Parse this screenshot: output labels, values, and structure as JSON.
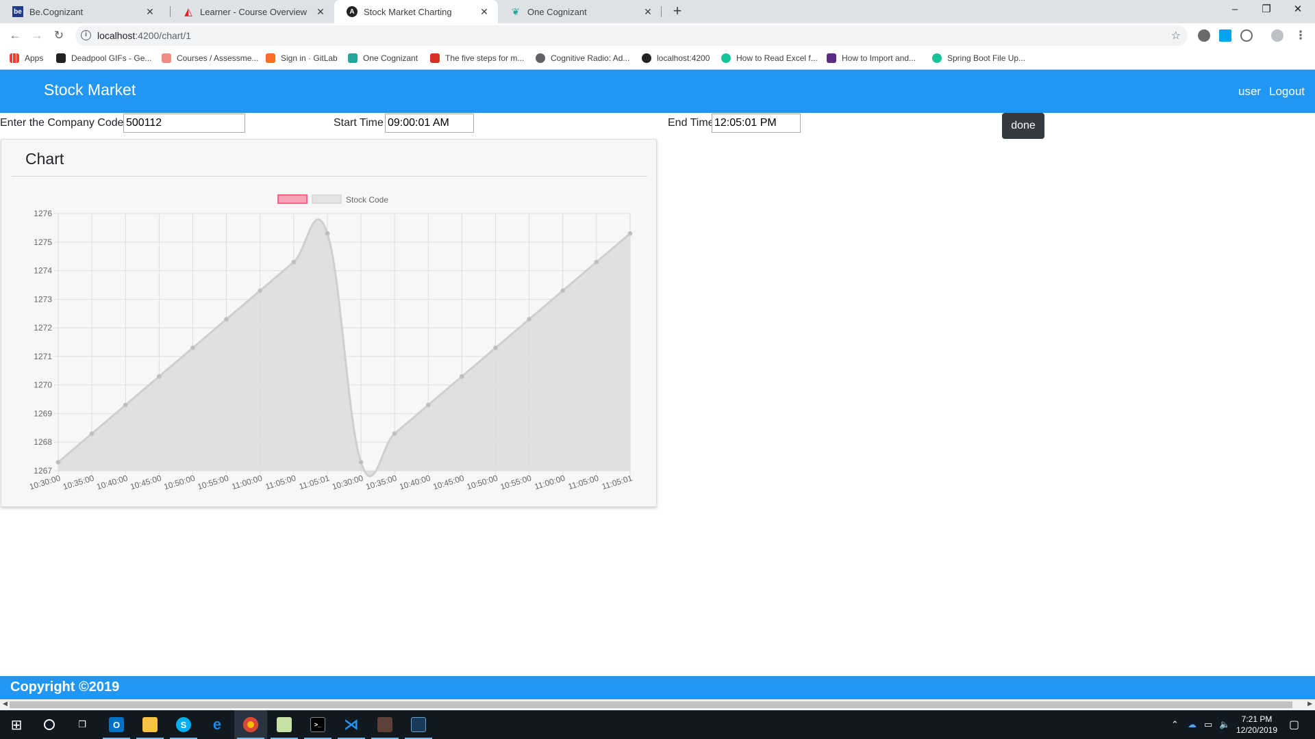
{
  "browser": {
    "tabs": [
      {
        "title": "Be.Cognizant",
        "icon": "be-cognizant-favicon",
        "active": false
      },
      {
        "title": "Learner - Course Overview",
        "icon": "adobe-favicon",
        "active": false
      },
      {
        "title": "Stock Market Charting",
        "icon": "angular-favicon",
        "active": true
      },
      {
        "title": "One Cognizant",
        "icon": "cognizant-favicon",
        "active": false
      }
    ],
    "new_tab_glyph": "+",
    "url_host": "localhost",
    "url_path": ":4200/chart/1",
    "bookmarks": [
      {
        "label": "Apps",
        "icon": "apps-grid-icon"
      },
      {
        "label": "Deadpool GIFs - Ge...",
        "icon": "bookmark-favicon"
      },
      {
        "label": "Courses / Assessme...",
        "icon": "courses-favicon"
      },
      {
        "label": "Sign in · GitLab",
        "icon": "gitlab-favicon"
      },
      {
        "label": "One Cognizant",
        "icon": "cognizant-favicon"
      },
      {
        "label": "The five steps for m...",
        "icon": "bookmark-favicon"
      },
      {
        "label": "Cognitive Radio: Ad...",
        "icon": "globe-favicon"
      },
      {
        "label": "localhost:4200",
        "icon": "angular-favicon"
      },
      {
        "label": "How to Read Excel f...",
        "icon": "grammarly-favicon"
      },
      {
        "label": "How to Import and...",
        "icon": "bookmark-favicon"
      },
      {
        "label": "Spring Boot File Up...",
        "icon": "grammarly-favicon"
      }
    ]
  },
  "app": {
    "brand": "Stock Market",
    "nav": {
      "user": "user",
      "logout": "Logout"
    },
    "form": {
      "company_label": "Enter the Company Code",
      "company_value": "500112",
      "start_label": "Start Time",
      "start_value": "09:00:01 AM",
      "end_label": "End Time",
      "end_value": "12:05:01 PM",
      "done_label": "done"
    },
    "card_title": "Chart",
    "footer": "Copyright ©2019"
  },
  "chart_data": {
    "type": "line",
    "fill": true,
    "legend_position": "top",
    "legend": [
      {
        "label": "",
        "color": "#ff6384"
      },
      {
        "label": "Stock Code",
        "color": "#dcdcdc"
      }
    ],
    "categories": [
      "10:30:00",
      "10:35:00",
      "10:40:00",
      "10:45:00",
      "10:50:00",
      "10:55:00",
      "11:00:00",
      "11:05:00",
      "11:05:01",
      "10:30:00",
      "10:35:00",
      "10:40:00",
      "10:45:00",
      "10:50:00",
      "10:55:00",
      "11:00:00",
      "11:05:00",
      "11:05:01"
    ],
    "series": [
      {
        "name": "Stock Code",
        "values": [
          1267.3,
          1268.3,
          1269.3,
          1270.3,
          1271.3,
          1272.3,
          1273.3,
          1274.3,
          1275.3,
          1267.3,
          1268.3,
          1269.3,
          1270.3,
          1271.3,
          1272.3,
          1273.3,
          1274.3,
          1275.3
        ]
      }
    ],
    "ylim": [
      1267,
      1276
    ],
    "yticks": [
      "1276",
      "1275",
      "1274",
      "1273",
      "1272",
      "1271",
      "1270",
      "1269",
      "1268",
      "1267"
    ],
    "grid": true,
    "colors": {
      "line": "#cfcfcf",
      "area": "#dcdcdc",
      "point": "#bdbdbd"
    }
  },
  "taskbar": {
    "items": [
      "windows-start-icon",
      "cortana-search-icon",
      "task-view-icon",
      "outlook-icon",
      "file-explorer-icon",
      "skype-icon",
      "edge-icon",
      "chrome-icon",
      "notepad-icon",
      "terminal-icon",
      "vscode-icon",
      "app-icon",
      "sts-icon"
    ],
    "time": "7:21 PM",
    "date": "12/20/2019"
  }
}
